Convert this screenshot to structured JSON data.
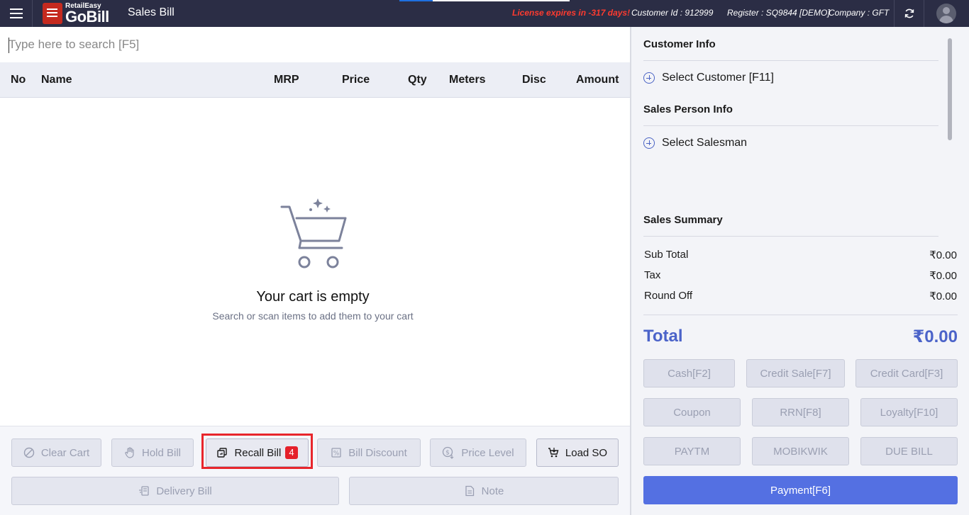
{
  "app": {
    "logo_small": "RetailEasy",
    "logo_big": "GoBill",
    "title": "Sales Bill",
    "license_text": "License expires in -317 days!",
    "customer_id": "Customer Id : 912999",
    "register": "Register : SQ9844 [DEMO]",
    "company": "Company : GFT"
  },
  "search": {
    "placeholder": "Type here to search [F5]"
  },
  "table": {
    "columns": [
      "No",
      "Name",
      "MRP",
      "Price",
      "Qty",
      "Meters",
      "Disc",
      "Amount"
    ]
  },
  "empty_cart": {
    "title": "Your cart is empty",
    "subtitle": "Search or scan items to add them to your cart"
  },
  "actions": {
    "clear_cart": "Clear Cart",
    "hold_bill": "Hold Bill",
    "recall_bill": "Recall Bill",
    "recall_count": "4",
    "bill_discount": "Bill Discount",
    "price_level": "Price Level",
    "load_so": "Load SO",
    "delivery_bill": "Delivery Bill",
    "note": "Note"
  },
  "sidebar": {
    "customer_info_title": "Customer Info",
    "select_customer": "Select Customer [F11]",
    "sales_person_title": "Sales Person Info",
    "select_salesman": "Select Salesman",
    "summary_title": "Sales Summary",
    "summary": [
      {
        "label": "Sub Total",
        "value": "₹0.00"
      },
      {
        "label": "Tax",
        "value": "₹0.00"
      },
      {
        "label": "Round Off",
        "value": "₹0.00"
      }
    ],
    "total_label": "Total",
    "total_value": "₹0.00"
  },
  "payment_buttons": {
    "cash": "Cash[F2]",
    "credit_sale": "Credit Sale[F7]",
    "credit_card": "Credit Card[F3]",
    "coupon": "Coupon",
    "rrn": "RRN[F8]",
    "loyalty": "Loyalty[F10]",
    "paytm": "PAYTM",
    "mobikwik": "MOBIKWIK",
    "due_bill": "DUE BILL",
    "payment": "Payment[F6]"
  },
  "colors": {
    "topbar": "#2b2d45",
    "license": "#ff3b2f",
    "accent": "#4b63c9",
    "payment_button": "#5470e2",
    "badge": "#e5202a"
  }
}
